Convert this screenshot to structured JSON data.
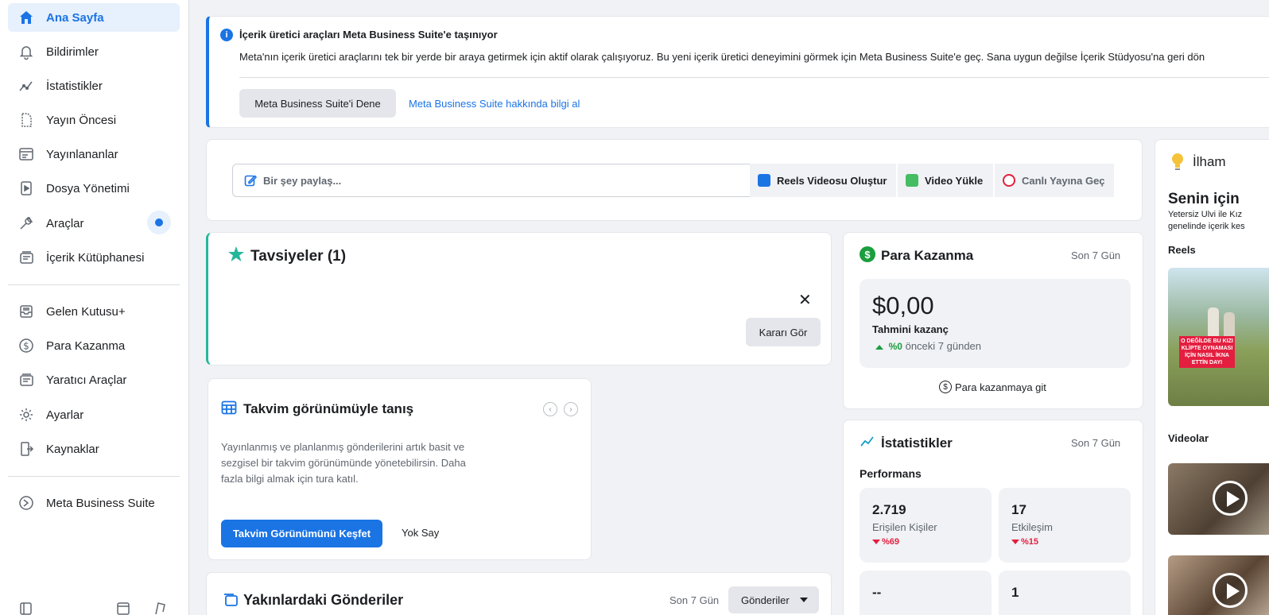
{
  "sidebar": {
    "items": [
      {
        "label": "Ana Sayfa",
        "icon": "home-icon"
      },
      {
        "label": "Bildirimler",
        "icon": "bell-icon"
      },
      {
        "label": "İstatistikler",
        "icon": "insights-icon"
      },
      {
        "label": "Yayın Öncesi",
        "icon": "draft-icon"
      },
      {
        "label": "Yayınlananlar",
        "icon": "published-icon"
      },
      {
        "label": "Dosya Yönetimi",
        "icon": "file-icon"
      },
      {
        "label": "Araçlar",
        "icon": "wrench-icon"
      },
      {
        "label": "İçerik Kütüphanesi",
        "icon": "library-icon"
      },
      {
        "label": "Gelen Kutusu+",
        "icon": "inbox-icon"
      },
      {
        "label": "Para Kazanma",
        "icon": "dollar-icon"
      },
      {
        "label": "Yaratıcı Araçlar",
        "icon": "creator-tools-icon"
      },
      {
        "label": "Ayarlar",
        "icon": "gear-icon"
      },
      {
        "label": "Kaynaklar",
        "icon": "resources-icon"
      },
      {
        "label": "Meta Business Suite",
        "icon": "meta-suite-icon"
      }
    ]
  },
  "banner": {
    "title": "İçerik üretici araçları Meta Business Suite'e taşınıyor",
    "text": "Meta'nın içerik üretici araçlarını tek bir yerde bir araya getirmek için aktif olarak çalışıyoruz. Bu yeni içerik üretici deneyimini görmek için Meta Business Suite'e geç. Sana uygun değilse İçerik Stüdyosu'na geri dön",
    "try_button": "Meta Business Suite'i Dene",
    "learn_link": "Meta Business Suite hakkında bilgi al"
  },
  "composer": {
    "placeholder": "Bir şey paylaş...",
    "reels": "Reels Videosu Oluştur",
    "upload": "Video Yükle",
    "live": "Canlı Yayına Geç"
  },
  "recommendations": {
    "title": "Tavsiyeler (1)",
    "decision_button": "Kararı Gör"
  },
  "calendar": {
    "title": "Takvim görünümüyle tanış",
    "description": "Yayınlanmış ve planlanmış gönderilerini artık basit ve sezgisel bir takvim görünümünde yönetebilirsin. Daha fazla bilgi almak için tura katıl.",
    "explore_button": "Takvim Görünümünü Keşfet",
    "ignore_button": "Yok Say"
  },
  "recent_posts": {
    "title": "Yakınlardaki Gönderiler",
    "period": "Son 7 Gün",
    "filter": "Gönderiler"
  },
  "monetization": {
    "title": "Para Kazanma",
    "period": "Son 7 Gün",
    "amount": "$0,00",
    "label": "Tahmini kazanç",
    "change": "%0",
    "change_note": "önceki 7 günden",
    "link": "Para kazanmaya git"
  },
  "insights": {
    "title": "İstatistikler",
    "period": "Son 7 Gün",
    "section": "Performans",
    "cards": [
      {
        "value": "2.719",
        "label": "Erişilen Kişiler",
        "change": "%69"
      },
      {
        "value": "17",
        "label": "Etkileşim",
        "change": "%15"
      },
      {
        "value": "--"
      },
      {
        "value": "1"
      }
    ]
  },
  "inspiration": {
    "title": "İlham",
    "for_you": "Senin için",
    "sub_line1": "Yetersiz Ulvi ile Kız",
    "sub_line2": "genelinde içerik kes",
    "reels_label": "Reels",
    "videos_label": "Videolar",
    "thumb_caption": "O DEĞİLDE BU KIZI KLİPTE OYNAMASI İÇİN NASIL İKNA ETTİN DAYI"
  },
  "colors": {
    "accent": "#1b74e4",
    "teal": "#25b79a",
    "green": "#1b9e3e",
    "red": "#e41e3f"
  }
}
